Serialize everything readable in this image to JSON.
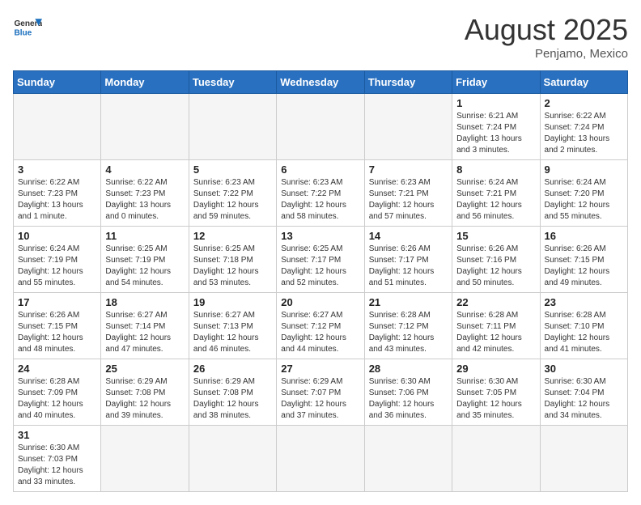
{
  "header": {
    "logo_general": "General",
    "logo_blue": "Blue",
    "month_year": "August 2025",
    "location": "Penjamo, Mexico"
  },
  "days_of_week": [
    "Sunday",
    "Monday",
    "Tuesday",
    "Wednesday",
    "Thursday",
    "Friday",
    "Saturday"
  ],
  "weeks": [
    [
      {
        "day": "",
        "info": ""
      },
      {
        "day": "",
        "info": ""
      },
      {
        "day": "",
        "info": ""
      },
      {
        "day": "",
        "info": ""
      },
      {
        "day": "",
        "info": ""
      },
      {
        "day": "1",
        "info": "Sunrise: 6:21 AM\nSunset: 7:24 PM\nDaylight: 13 hours and 3 minutes."
      },
      {
        "day": "2",
        "info": "Sunrise: 6:22 AM\nSunset: 7:24 PM\nDaylight: 13 hours and 2 minutes."
      }
    ],
    [
      {
        "day": "3",
        "info": "Sunrise: 6:22 AM\nSunset: 7:23 PM\nDaylight: 13 hours and 1 minute."
      },
      {
        "day": "4",
        "info": "Sunrise: 6:22 AM\nSunset: 7:23 PM\nDaylight: 13 hours and 0 minutes."
      },
      {
        "day": "5",
        "info": "Sunrise: 6:23 AM\nSunset: 7:22 PM\nDaylight: 12 hours and 59 minutes."
      },
      {
        "day": "6",
        "info": "Sunrise: 6:23 AM\nSunset: 7:22 PM\nDaylight: 12 hours and 58 minutes."
      },
      {
        "day": "7",
        "info": "Sunrise: 6:23 AM\nSunset: 7:21 PM\nDaylight: 12 hours and 57 minutes."
      },
      {
        "day": "8",
        "info": "Sunrise: 6:24 AM\nSunset: 7:21 PM\nDaylight: 12 hours and 56 minutes."
      },
      {
        "day": "9",
        "info": "Sunrise: 6:24 AM\nSunset: 7:20 PM\nDaylight: 12 hours and 55 minutes."
      }
    ],
    [
      {
        "day": "10",
        "info": "Sunrise: 6:24 AM\nSunset: 7:19 PM\nDaylight: 12 hours and 55 minutes."
      },
      {
        "day": "11",
        "info": "Sunrise: 6:25 AM\nSunset: 7:19 PM\nDaylight: 12 hours and 54 minutes."
      },
      {
        "day": "12",
        "info": "Sunrise: 6:25 AM\nSunset: 7:18 PM\nDaylight: 12 hours and 53 minutes."
      },
      {
        "day": "13",
        "info": "Sunrise: 6:25 AM\nSunset: 7:17 PM\nDaylight: 12 hours and 52 minutes."
      },
      {
        "day": "14",
        "info": "Sunrise: 6:26 AM\nSunset: 7:17 PM\nDaylight: 12 hours and 51 minutes."
      },
      {
        "day": "15",
        "info": "Sunrise: 6:26 AM\nSunset: 7:16 PM\nDaylight: 12 hours and 50 minutes."
      },
      {
        "day": "16",
        "info": "Sunrise: 6:26 AM\nSunset: 7:15 PM\nDaylight: 12 hours and 49 minutes."
      }
    ],
    [
      {
        "day": "17",
        "info": "Sunrise: 6:26 AM\nSunset: 7:15 PM\nDaylight: 12 hours and 48 minutes."
      },
      {
        "day": "18",
        "info": "Sunrise: 6:27 AM\nSunset: 7:14 PM\nDaylight: 12 hours and 47 minutes."
      },
      {
        "day": "19",
        "info": "Sunrise: 6:27 AM\nSunset: 7:13 PM\nDaylight: 12 hours and 46 minutes."
      },
      {
        "day": "20",
        "info": "Sunrise: 6:27 AM\nSunset: 7:12 PM\nDaylight: 12 hours and 44 minutes."
      },
      {
        "day": "21",
        "info": "Sunrise: 6:28 AM\nSunset: 7:12 PM\nDaylight: 12 hours and 43 minutes."
      },
      {
        "day": "22",
        "info": "Sunrise: 6:28 AM\nSunset: 7:11 PM\nDaylight: 12 hours and 42 minutes."
      },
      {
        "day": "23",
        "info": "Sunrise: 6:28 AM\nSunset: 7:10 PM\nDaylight: 12 hours and 41 minutes."
      }
    ],
    [
      {
        "day": "24",
        "info": "Sunrise: 6:28 AM\nSunset: 7:09 PM\nDaylight: 12 hours and 40 minutes."
      },
      {
        "day": "25",
        "info": "Sunrise: 6:29 AM\nSunset: 7:08 PM\nDaylight: 12 hours and 39 minutes."
      },
      {
        "day": "26",
        "info": "Sunrise: 6:29 AM\nSunset: 7:08 PM\nDaylight: 12 hours and 38 minutes."
      },
      {
        "day": "27",
        "info": "Sunrise: 6:29 AM\nSunset: 7:07 PM\nDaylight: 12 hours and 37 minutes."
      },
      {
        "day": "28",
        "info": "Sunrise: 6:30 AM\nSunset: 7:06 PM\nDaylight: 12 hours and 36 minutes."
      },
      {
        "day": "29",
        "info": "Sunrise: 6:30 AM\nSunset: 7:05 PM\nDaylight: 12 hours and 35 minutes."
      },
      {
        "day": "30",
        "info": "Sunrise: 6:30 AM\nSunset: 7:04 PM\nDaylight: 12 hours and 34 minutes."
      }
    ],
    [
      {
        "day": "31",
        "info": "Sunrise: 6:30 AM\nSunset: 7:03 PM\nDaylight: 12 hours and 33 minutes."
      },
      {
        "day": "",
        "info": ""
      },
      {
        "day": "",
        "info": ""
      },
      {
        "day": "",
        "info": ""
      },
      {
        "day": "",
        "info": ""
      },
      {
        "day": "",
        "info": ""
      },
      {
        "day": "",
        "info": ""
      }
    ]
  ]
}
